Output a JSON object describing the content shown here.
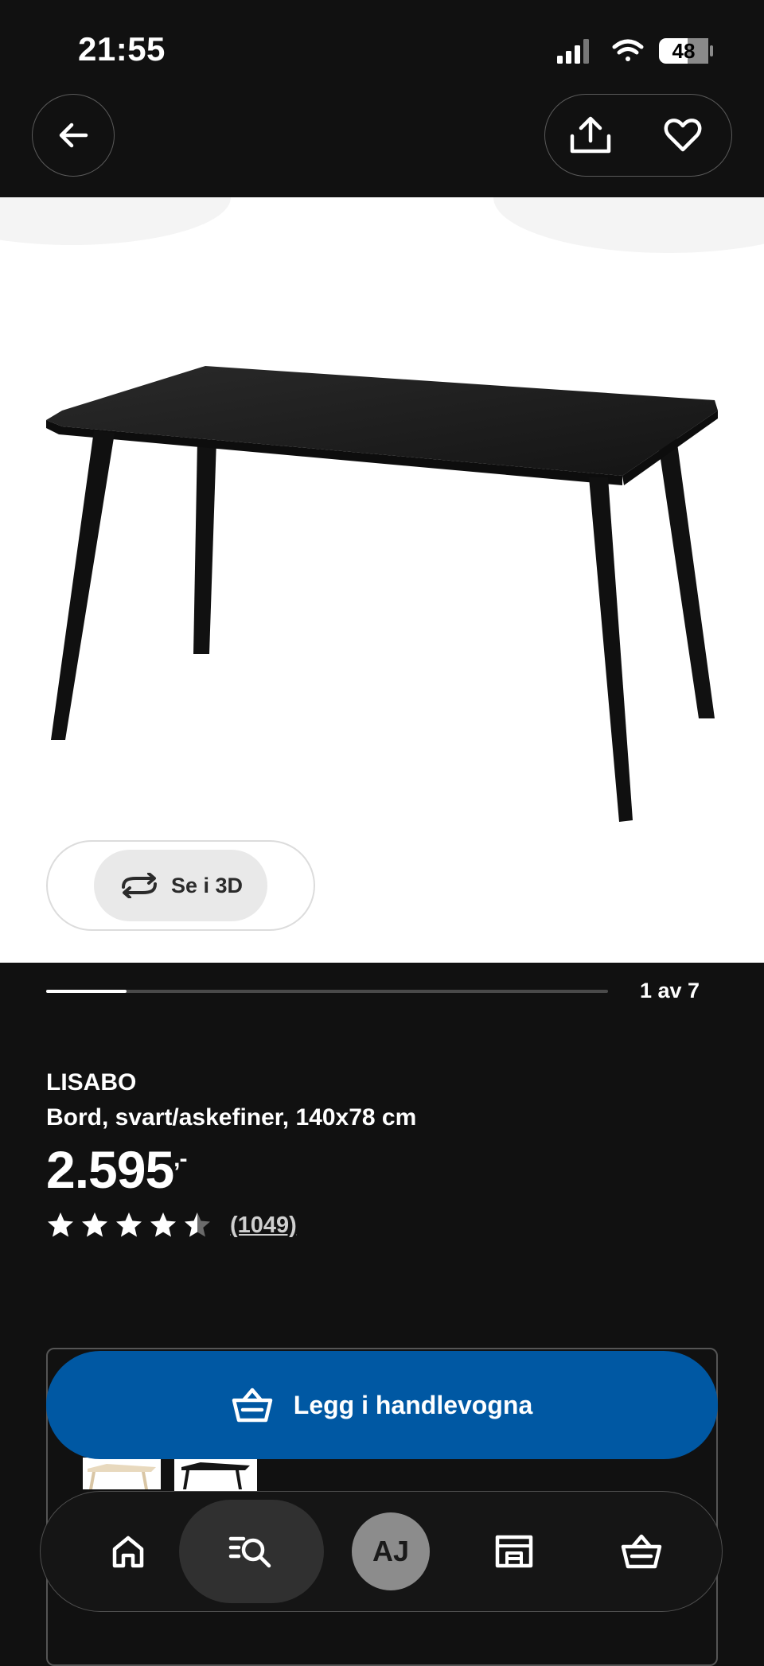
{
  "status_bar": {
    "time": "21:55",
    "battery": "48"
  },
  "header": {
    "back_icon": "arrow-left-icon",
    "share_icon": "share-icon",
    "favorite_icon": "heart-icon"
  },
  "gallery": {
    "view_3d_label": "Se i 3D",
    "view_3d_icon": "rotate-icon",
    "pager_label": "1 av 7",
    "current_image": 1,
    "total_images": 7
  },
  "product": {
    "name": "LISABO",
    "description": "Bord, svart/askefiner, 140x78 cm",
    "price": "2.595",
    "price_suffix": ",-",
    "rating": 4.5,
    "rating_max": 5,
    "review_count": "(1049)"
  },
  "cart": {
    "add_label": "Legg i handlevogna",
    "icon": "basket-icon",
    "button_color": "#0058a3"
  },
  "bottom_nav": {
    "items": [
      {
        "name": "home",
        "icon": "home-icon"
      },
      {
        "name": "search",
        "icon": "search-list-icon",
        "active": true
      },
      {
        "name": "profile",
        "avatar_initials": "AJ"
      },
      {
        "name": "store",
        "icon": "store-icon"
      },
      {
        "name": "cart",
        "icon": "basket-icon"
      }
    ]
  }
}
